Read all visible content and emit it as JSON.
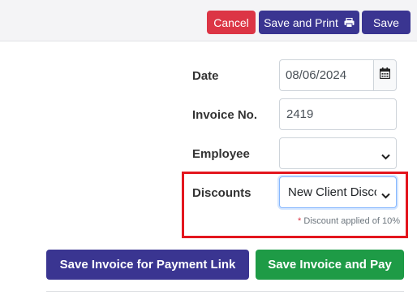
{
  "toolbar": {
    "cancel_label": "Cancel",
    "save_print_label": "Save and Print",
    "save_label": "Save"
  },
  "form": {
    "date_label": "Date",
    "date_value": "08/06/2024",
    "invoice_label": "Invoice No.",
    "invoice_value": "2419",
    "employee_label": "Employee",
    "employee_value": "",
    "discounts_label": "Discounts",
    "discounts_value": "New Client Discount",
    "discount_note_star": "*",
    "discount_note": "Discount applied of 10%"
  },
  "actions": {
    "payment_link_label": "Save Invoice for Payment Link",
    "pay_label": "Save Invoice and Pay"
  },
  "colors": {
    "primary": "#3a3591",
    "danger": "#dc3545",
    "success": "#1e9b46",
    "highlight": "#e3161e"
  },
  "icons": {
    "print": "printer-icon",
    "calendar": "calendar-icon",
    "select": "chevron-down-icon"
  }
}
